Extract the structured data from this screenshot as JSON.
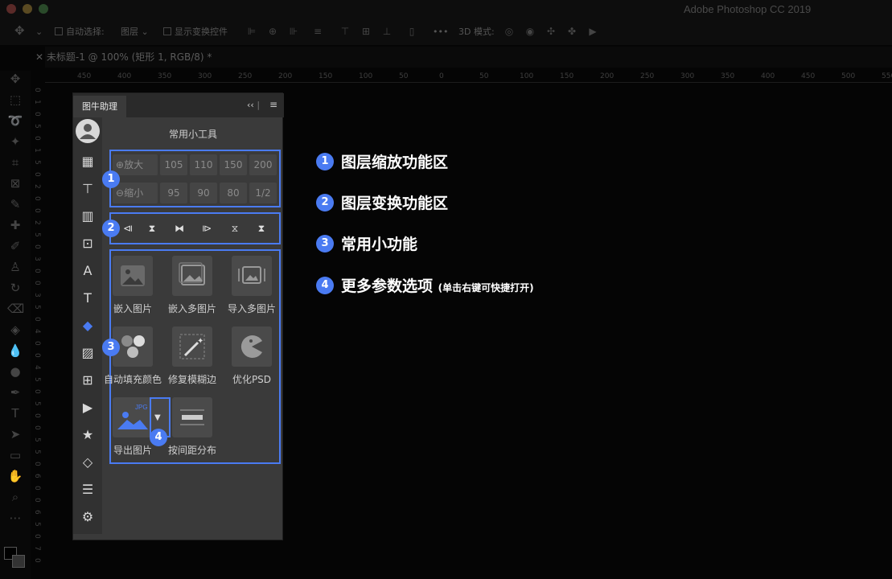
{
  "app": {
    "title": "Adobe Photoshop CC 2019"
  },
  "options_bar": {
    "auto_select_label": "自动选择:",
    "auto_select_value": "图层",
    "show_transform_label": "显示变换控件",
    "mode_3d_label": "3D 模式:",
    "more": "•••"
  },
  "document": {
    "tab_title": "未标题-1 @ 100% (矩形 1, RGB/8) *"
  },
  "ruler": {
    "top_ticks": [
      "450",
      "400",
      "350",
      "300",
      "250",
      "200",
      "150",
      "100",
      "50",
      "0",
      "50",
      "100",
      "150",
      "200",
      "250",
      "300",
      "350",
      "400",
      "450",
      "500",
      "550"
    ],
    "left_ticks": [
      "0",
      "1",
      "0",
      "5",
      "0",
      "1",
      "5",
      "0",
      "2",
      "0",
      "0",
      "2",
      "5",
      "0",
      "3",
      "0",
      "0",
      "3",
      "5",
      "0",
      "4",
      "0",
      "0",
      "4",
      "5",
      "0",
      "5",
      "0",
      "0",
      "5",
      "5",
      "0",
      "6",
      "0",
      "0",
      "6",
      "5",
      "0",
      "7",
      "0"
    ]
  },
  "panel": {
    "tab_label": "图牛助理",
    "collapse": "‹‹",
    "menu": "≡",
    "title": "常用小工具",
    "zoom_in_label": "放大",
    "zoom_out_label": "缩小",
    "zoom_in_values": [
      "105",
      "110",
      "150",
      "200"
    ],
    "zoom_out_values": [
      "95",
      "90",
      "80",
      "1/2"
    ],
    "tools": [
      {
        "label": "嵌入图片",
        "icon": "image-icon"
      },
      {
        "label": "嵌入多图片",
        "icon": "images-icon"
      },
      {
        "label": "导入多图片",
        "icon": "import-images-icon"
      },
      {
        "label": "自动填充颜色",
        "icon": "color-circles-icon"
      },
      {
        "label": "修复模糊边",
        "icon": "magic-wand-icon"
      },
      {
        "label": "优化PSD",
        "icon": "pacman-icon"
      },
      {
        "label": "导出图片",
        "icon": "export-jpg-icon",
        "tag": "JPG"
      },
      {
        "label": "按间距分布",
        "icon": "distribute-icon"
      }
    ]
  },
  "legend": [
    {
      "num": "1",
      "text": "图层缩放功能区",
      "note": ""
    },
    {
      "num": "2",
      "text": "图层变换功能区",
      "note": ""
    },
    {
      "num": "3",
      "text": "常用小功能",
      "note": ""
    },
    {
      "num": "4",
      "text": "更多参数选项",
      "note": "(单击右键可快捷打开)"
    }
  ],
  "colors": {
    "accent": "#4a7bf2",
    "panel_bg": "#3a3a3a",
    "sidebar_bg": "#313131",
    "canvas_bg": "#050505"
  }
}
